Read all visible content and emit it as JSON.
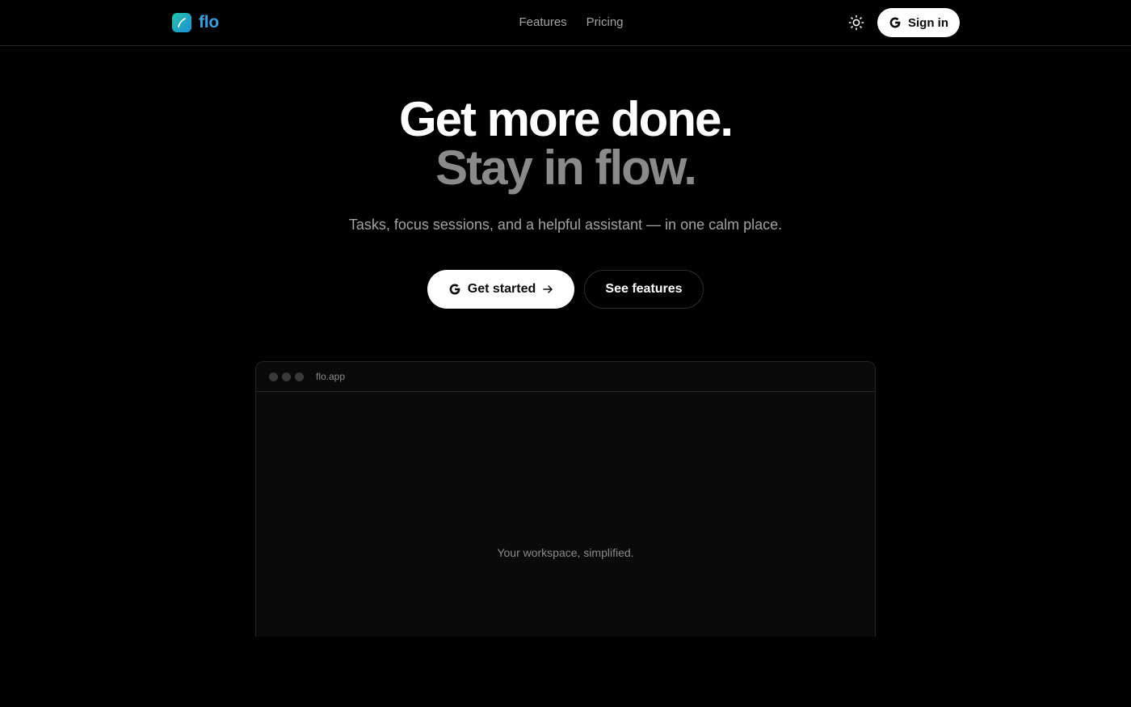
{
  "brand": {
    "name": "flo",
    "logo_icon": "brush-stroke-icon",
    "colors": {
      "name": "#3b9fe0",
      "logo_from": "#22c3a6",
      "logo_to": "#1f8fd6"
    }
  },
  "nav": {
    "items": [
      {
        "label": "Features"
      },
      {
        "label": "Pricing"
      }
    ]
  },
  "header_actions": {
    "theme_toggle_icon": "sun-icon",
    "signin_label": "Sign in",
    "signin_icon": "google-icon"
  },
  "hero": {
    "headline_line1": "Get more done.",
    "headline_line2": "Stay in flow.",
    "subtitle": "Tasks, focus sessions, and a helpful assistant — in one calm place.",
    "primary_cta": "Get started",
    "primary_cta_icons": [
      "google-icon",
      "arrow-right-icon"
    ],
    "secondary_cta": "See features"
  },
  "preview": {
    "url": "flo.app",
    "caption": "Your workspace, simplified."
  },
  "colors": {
    "background": "#000000",
    "text_primary": "#ffffff",
    "text_muted": "#a3a3a3",
    "headline_secondary": "#8a8a8a",
    "border": "#262626"
  }
}
